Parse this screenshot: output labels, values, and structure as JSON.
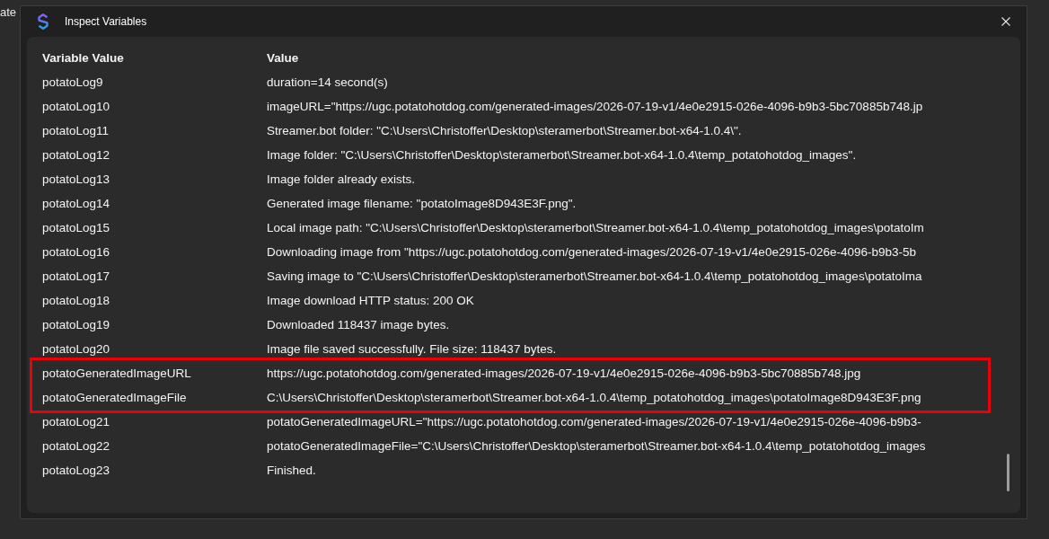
{
  "background": {
    "text": "ate"
  },
  "window": {
    "title": "Inspect Variables"
  },
  "table": {
    "columns": [
      "Variable Value",
      "Value"
    ],
    "rows": [
      {
        "name": "potatoLog9",
        "value": "duration=14 second(s)",
        "highlighted": false
      },
      {
        "name": "potatoLog10",
        "value": "imageURL=\"https://ugc.potatohotdog.com/generated-images/2026-07-19-v1/4e0e2915-026e-4096-b9b3-5bc70885b748.jp",
        "highlighted": false
      },
      {
        "name": "potatoLog11",
        "value": "Streamer.bot folder: \"C:\\Users\\Christoffer\\Desktop\\steramerbot\\Streamer.bot-x64-1.0.4\\\".",
        "highlighted": false
      },
      {
        "name": "potatoLog12",
        "value": "Image folder: \"C:\\Users\\Christoffer\\Desktop\\steramerbot\\Streamer.bot-x64-1.0.4\\temp_potatohotdog_images\".",
        "highlighted": false
      },
      {
        "name": "potatoLog13",
        "value": "Image folder already exists.",
        "highlighted": false
      },
      {
        "name": "potatoLog14",
        "value": "Generated image filename: \"potatoImage8D943E3F.png\".",
        "highlighted": false
      },
      {
        "name": "potatoLog15",
        "value": "Local image path: \"C:\\Users\\Christoffer\\Desktop\\steramerbot\\Streamer.bot-x64-1.0.4\\temp_potatohotdog_images\\potatoIm",
        "highlighted": false
      },
      {
        "name": "potatoLog16",
        "value": "Downloading image from \"https://ugc.potatohotdog.com/generated-images/2026-07-19-v1/4e0e2915-026e-4096-b9b3-5b",
        "highlighted": false
      },
      {
        "name": "potatoLog17",
        "value": "Saving image to \"C:\\Users\\Christoffer\\Desktop\\steramerbot\\Streamer.bot-x64-1.0.4\\temp_potatohotdog_images\\potatoIma",
        "highlighted": false
      },
      {
        "name": "potatoLog18",
        "value": "Image download HTTP status: 200 OK",
        "highlighted": false
      },
      {
        "name": "potatoLog19",
        "value": "Downloaded 118437 image bytes.",
        "highlighted": false
      },
      {
        "name": "potatoLog20",
        "value": "Image file saved successfully. File size: 118437 bytes.",
        "highlighted": false
      },
      {
        "name": "potatoGeneratedImageURL",
        "value": "https://ugc.potatohotdog.com/generated-images/2026-07-19-v1/4e0e2915-026e-4096-b9b3-5bc70885b748.jpg",
        "highlighted": true
      },
      {
        "name": "potatoGeneratedImageFile",
        "value": "C:\\Users\\Christoffer\\Desktop\\steramerbot\\Streamer.bot-x64-1.0.4\\temp_potatohotdog_images\\potatoImage8D943E3F.png",
        "highlighted": true
      },
      {
        "name": "potatoLog21",
        "value": "potatoGeneratedImageURL=\"https://ugc.potatohotdog.com/generated-images/2026-07-19-v1/4e0e2915-026e-4096-b9b3-",
        "highlighted": false
      },
      {
        "name": "potatoLog22",
        "value": "potatoGeneratedImageFile=\"C:\\Users\\Christoffer\\Desktop\\steramerbot\\Streamer.bot-x64-1.0.4\\temp_potatohotdog_images",
        "highlighted": false
      },
      {
        "name": "potatoLog23",
        "value": "Finished.",
        "highlighted": false
      }
    ]
  }
}
